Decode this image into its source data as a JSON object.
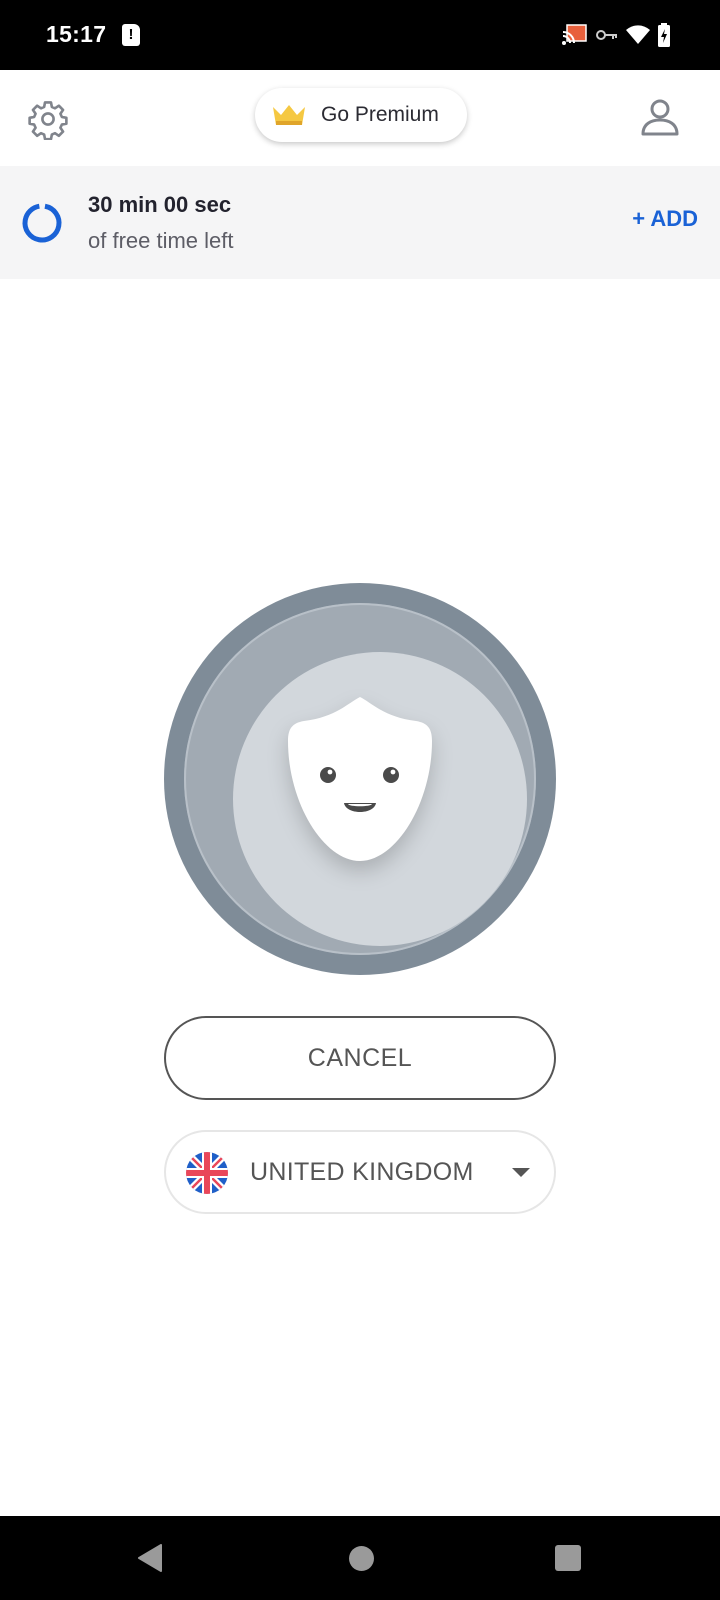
{
  "status_bar": {
    "time": "15:17",
    "alert_glyph": "!",
    "icons": [
      "cast-icon",
      "vpn-key-icon",
      "wifi-icon",
      "battery-charging-icon"
    ]
  },
  "header": {
    "settings_icon": "gear-icon",
    "premium_label": "Go Premium",
    "premium_icon": "crown-icon",
    "account_icon": "user-icon"
  },
  "timer": {
    "time_left": "30 min 00 sec",
    "caption": "of free time left",
    "add_label": "+ ADD",
    "progress_fraction": 0.95,
    "accent_color": "#1a62d6"
  },
  "connect": {
    "state": "connecting",
    "mascot_icon": "shield-face-icon"
  },
  "actions": {
    "cancel_label": "CANCEL"
  },
  "location": {
    "country": "UNITED KINGDOM",
    "flag_icon": "uk-flag-icon"
  },
  "nav": {
    "back": "back-icon",
    "home": "home-icon",
    "recents": "recents-icon"
  }
}
